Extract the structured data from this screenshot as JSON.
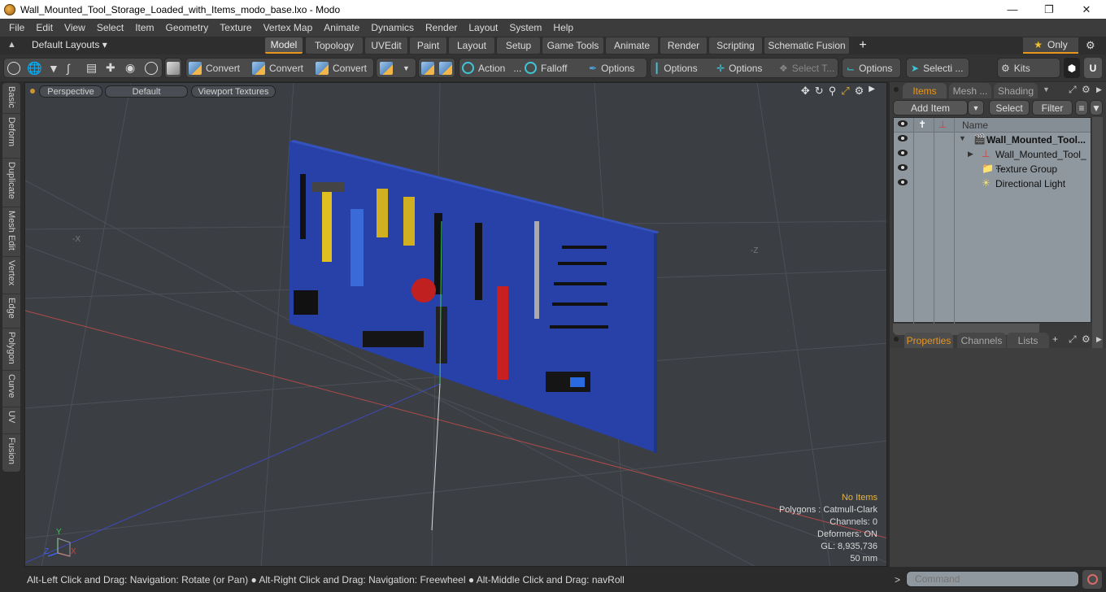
{
  "window": {
    "title": "Wall_Mounted_Tool_Storage_Loaded_with_Items_modo_base.lxo - Modo",
    "controls": [
      "minimize",
      "maximize",
      "close"
    ]
  },
  "menu": [
    "File",
    "Edit",
    "View",
    "Select",
    "Item",
    "Geometry",
    "Texture",
    "Vertex Map",
    "Animate",
    "Dynamics",
    "Render",
    "Layout",
    "System",
    "Help"
  ],
  "layout_bar": {
    "layouts_label": "Default Layouts ▾",
    "tabs": [
      "Model",
      "Topology",
      "UVEdit",
      "Paint",
      "Layout",
      "Setup",
      "Game Tools",
      "Animate",
      "Render",
      "Scripting",
      "Schematic Fusion"
    ],
    "active_tab": "Model",
    "add_tab": "+",
    "only_label": "Only"
  },
  "toolbar": {
    "convert_1": "Convert",
    "convert_2": "Convert",
    "convert_3": "Convert",
    "action": "Action",
    "action_more": "...",
    "falloff": "Falloff",
    "options_1": "Options",
    "options_2": "Options",
    "options_3": "Options",
    "select_t": "Select T...",
    "options_4": "Options",
    "selecti": "Selecti ...",
    "kits": "Kits"
  },
  "side_tabs": [
    "Basic",
    "Deform",
    "Duplicate",
    "Mesh Edit",
    "Vertex",
    "Edge",
    "Polygon",
    "Curve",
    "UV",
    "Fusion"
  ],
  "viewport": {
    "view_mode": "Perspective",
    "shading": "Default",
    "textures": "Viewport Textures",
    "axis_labels": {
      "neg_x": "-X",
      "neg_z": "-Z"
    },
    "gizmo": {
      "x": "X",
      "y": "Y",
      "z": "Z"
    },
    "info": {
      "selection": "No Items",
      "polygons": "Polygons : Catmull-Clark",
      "channels": "Channels: 0",
      "deformers": "Deformers: ON",
      "gl": "GL: 8,935,736",
      "unit": "50 mm"
    },
    "colors": {
      "background": "#3b3f44",
      "pegboard": "#2741a8",
      "x_axis": "#c0504d",
      "z_axis": "#4040c0",
      "y_axis": "#40d060"
    }
  },
  "items_panel": {
    "tabs": [
      "Items",
      "Mesh ...",
      "Shading"
    ],
    "active_tab": "Items",
    "add_item": "Add Item",
    "select": "Select",
    "filter": "Filter",
    "column_name": "Name",
    "tree": [
      {
        "label": "Wall_Mounted_Tool...",
        "type": "scene",
        "bold": true,
        "expanded": true
      },
      {
        "label": "Wall_Mounted_Tool_ ...",
        "type": "mesh",
        "bold": false,
        "expanded": false
      },
      {
        "label": "Texture Group",
        "type": "texture-group",
        "bold": false
      },
      {
        "label": "Directional Light",
        "type": "light",
        "bold": false
      }
    ]
  },
  "properties_panel": {
    "tabs": [
      "Properties",
      "Channels",
      "Lists"
    ],
    "active_tab": "Properties",
    "add": "+"
  },
  "status": {
    "hint_1": "Alt-Left Click and Drag: Navigation: Rotate (or Pan)",
    "hint_2": "Alt-Right Click and Drag: Navigation: Freewheel",
    "hint_3": "Alt-Middle Click and Drag: navRoll",
    "prompt": ">",
    "command_placeholder": "Command"
  }
}
